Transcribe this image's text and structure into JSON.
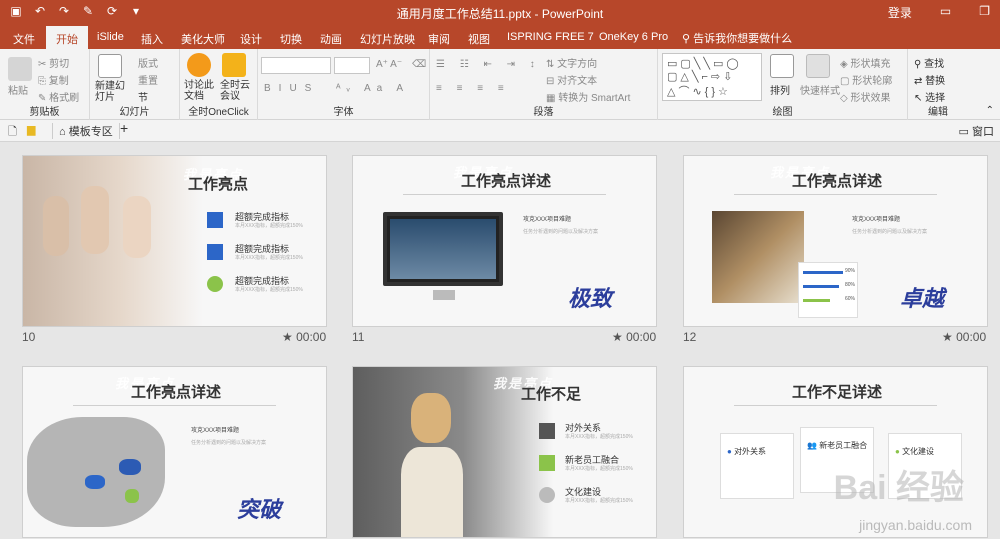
{
  "titlebar": {
    "title": "通用月度工作总结11.pptx  -  PowerPoint",
    "login": "登录"
  },
  "tabs": [
    "文件",
    "开始",
    "iSlide",
    "插入",
    "美化大师",
    "设计",
    "切换",
    "动画",
    "幻灯片放映",
    "审阅",
    "视图",
    "ISPRING FREE 7",
    "OneKey 6 Pro"
  ],
  "tell_me": "告诉我你想要做什么",
  "ribbon": {
    "clipboard": {
      "paste": "粘贴",
      "cut": "剪切",
      "copy": "复制",
      "format": "格式刷",
      "label": "剪贴板"
    },
    "slides": {
      "new": "新建幻灯片",
      "layout": "版式",
      "reset": "重置",
      "section": "节",
      "label": "幻灯片"
    },
    "onclick": {
      "discuss": "讨论此文档",
      "cloud": "全时云会议",
      "label": "全时OneClick"
    },
    "font": {
      "label": "字体"
    },
    "paragraph": {
      "text_dir": "文字方向",
      "align": "对齐文本",
      "smartart": "转换为 SmartArt",
      "label": "段落"
    },
    "drawing": {
      "arrange": "排列",
      "quick": "快速样式",
      "fill": "形状填充",
      "outline": "形状轮廓",
      "effect": "形状效果",
      "label": "绘图"
    },
    "editing": {
      "find": "查找",
      "replace": "替换",
      "select": "选择",
      "label": "编辑"
    }
  },
  "toolbar2": {
    "template": "模板专区",
    "window": "窗口"
  },
  "slides": [
    {
      "num": "10",
      "time": "00:00",
      "title": "工作亮点",
      "items": [
        "超额完成指标",
        "超额完成指标",
        "超额完成指标"
      ],
      "sub": "本月XXX指标，超额完成150%"
    },
    {
      "num": "11",
      "time": "00:00",
      "title": "工作亮点详述",
      "heading": "攻克XXX项目难题",
      "body": "任务分析遇到的问题以及解决方案",
      "brush": "极致"
    },
    {
      "num": "12",
      "time": "00:00",
      "title": "工作亮点详述",
      "heading": "攻克XXX项目难题",
      "body": "任务分析遇到的问题以及解决方案",
      "brush": "卓越",
      "bars": [
        "90%",
        "80%",
        "60%"
      ]
    },
    {
      "num": "",
      "time": "",
      "title": "工作亮点详述",
      "heading": "攻克XXX项目难题",
      "body": "任务分析遇到的问题以及解决方案",
      "brush": "突破"
    },
    {
      "num": "",
      "time": "",
      "title": "工作不足",
      "items": [
        "对外关系",
        "新老员工融合",
        "文化建设"
      ],
      "sub": "本月XXX指标，超额完成150%"
    },
    {
      "num": "",
      "time": "",
      "title": "工作不足详述",
      "cards": [
        "对外关系",
        "新老员工融合",
        "文化建设"
      ]
    }
  ],
  "watermark": {
    "main": "Bai 经验",
    "url": "jingyan.baidu.com"
  },
  "colors": {
    "accent": "#b7472a",
    "icon_blue": "#2c66c8"
  }
}
